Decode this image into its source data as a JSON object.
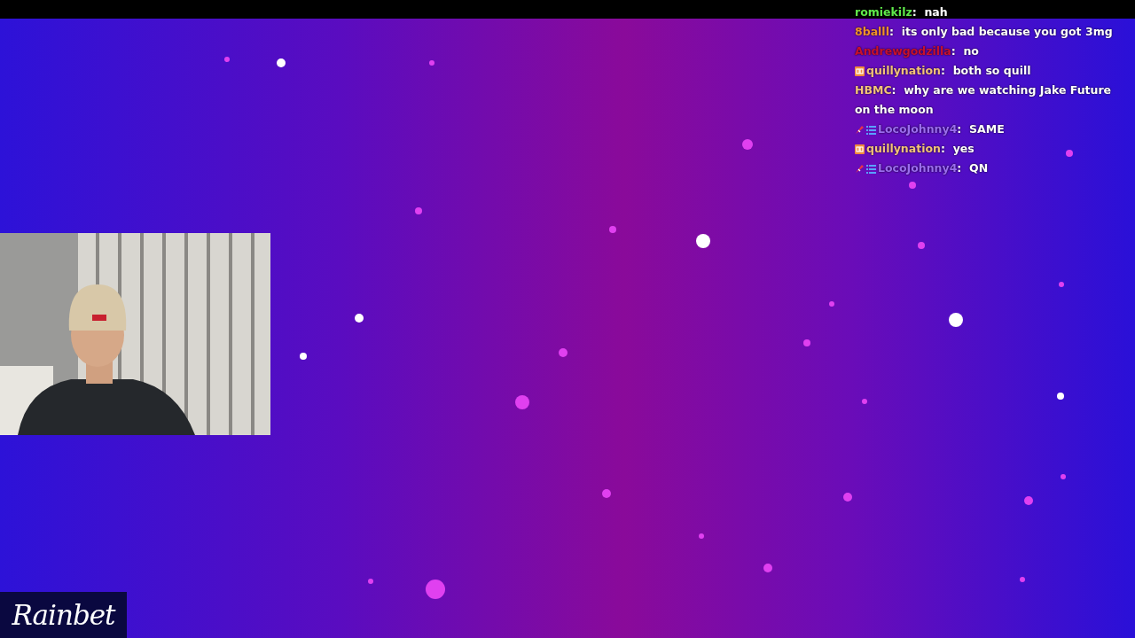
{
  "chat": {
    "messages": [
      {
        "user": "romiekilz",
        "color": "#5fe84a",
        "separator": ":",
        "text": "nah"
      },
      {
        "user": "8balll",
        "color": "#f0902a",
        "separator": ":",
        "text": "its only bad because you got 3mg"
      },
      {
        "user": "Andrewgodzilla",
        "color": "#c8102e",
        "separator": ":",
        "text": "no"
      },
      {
        "user": "quillynation",
        "color": "#f4c27a",
        "badges": [
          {
            "kind": "og"
          }
        ],
        "separator": ":",
        "text": "both so quill"
      },
      {
        "user": "HBMC",
        "color": "#f4c27a",
        "separator": ":",
        "text": "why are we watching Jake Future on the moon"
      },
      {
        "user": "LocoJohnny4",
        "color": "#9b6cf0",
        "badges": [
          {
            "kind": "rocket"
          },
          {
            "kind": "grid"
          }
        ],
        "separator": ":",
        "text": "SAME"
      },
      {
        "user": "quillynation",
        "color": "#f4c27a",
        "badges": [
          {
            "kind": "og"
          }
        ],
        "separator": ":",
        "text": "yes"
      },
      {
        "user": "LocoJohnny4",
        "color": "#9b6cf0",
        "badges": [
          {
            "kind": "rocket"
          },
          {
            "kind": "grid"
          }
        ],
        "separator": ":",
        "text": "QN"
      }
    ]
  },
  "logo": {
    "text": "Rainbet"
  }
}
